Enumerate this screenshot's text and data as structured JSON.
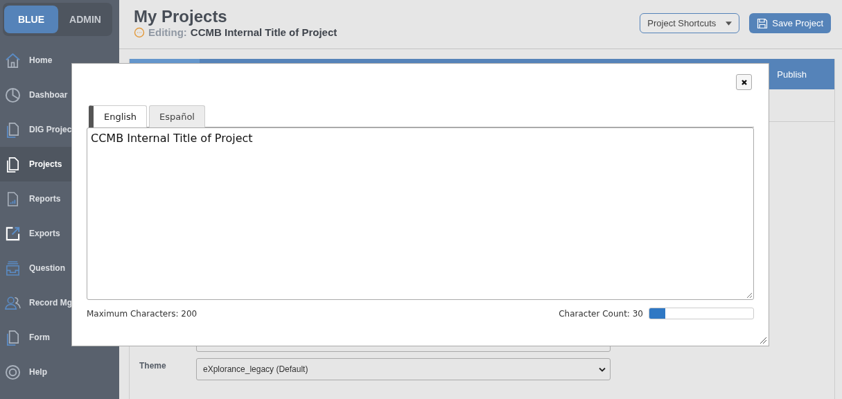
{
  "brand": [
    {
      "label": "BLUE",
      "selected": true
    },
    {
      "label": "ADMIN",
      "selected": false
    }
  ],
  "sidebar": {
    "items": [
      {
        "label": "Home",
        "selected": false
      },
      {
        "label": "Dashboar",
        "selected": false
      },
      {
        "label": "DIG Projec",
        "selected": false
      },
      {
        "label": "Projects",
        "selected": true
      },
      {
        "label": "Reports",
        "selected": false
      },
      {
        "label": "Exports",
        "selected": false
      },
      {
        "label": "Question",
        "selected": false
      },
      {
        "label": "Record Mg",
        "selected": false
      },
      {
        "label": "Form",
        "selected": false
      },
      {
        "label": "Help",
        "selected": false
      }
    ]
  },
  "header": {
    "title": "My Projects",
    "editing_label": "Editing:",
    "project_title": "CCMB Internal Title of Project",
    "shortcuts": "Project Shortcuts",
    "save": "Save Project"
  },
  "tab_bar": {
    "label": "Publish"
  },
  "form": {
    "theme_label": "Theme",
    "theme_value": "eXplorance_legacy (Default)"
  },
  "modal": {
    "tabs": [
      {
        "label": "English",
        "selected": true
      },
      {
        "label": "Español",
        "selected": false
      }
    ],
    "value": "CCMB Internal Title of Project",
    "max_label": "Maximum Characters: 200",
    "count_label": "Character Count: 30",
    "level": 0.15
  }
}
